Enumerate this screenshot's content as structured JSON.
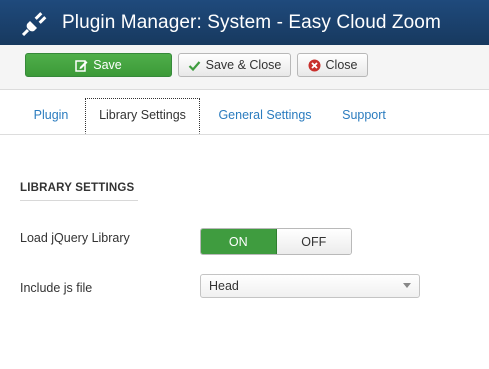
{
  "header": {
    "title": "Plugin Manager: System - Easy Cloud Zoom",
    "icon": "plug-icon"
  },
  "toolbar": {
    "save_label": "Save",
    "save_close_label": "Save & Close",
    "close_label": "Close"
  },
  "tabs": [
    {
      "label": "Plugin",
      "active": false
    },
    {
      "label": "Library Settings",
      "active": true
    },
    {
      "label": "General Settings",
      "active": false
    },
    {
      "label": "Support",
      "active": false
    }
  ],
  "section": {
    "title": "LIBRARY SETTINGS"
  },
  "fields": {
    "jquery": {
      "label": "Load jQuery Library",
      "on_label": "ON",
      "off_label": "OFF",
      "selected": "ON"
    },
    "jsfile": {
      "label": "Include js file",
      "value": "Head"
    }
  },
  "colors": {
    "header_bg": "#1f4a7c",
    "save_green": "#46a443",
    "link_blue": "#2b7cbf",
    "close_red": "#c9302c"
  }
}
